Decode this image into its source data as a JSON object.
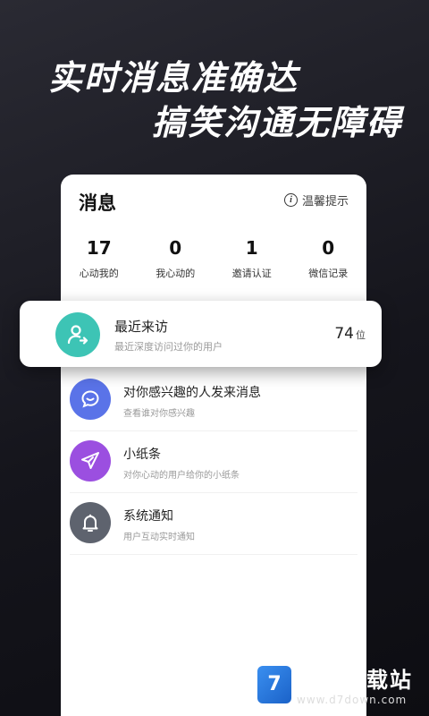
{
  "headline": {
    "line1": "实时消息准确达",
    "line2": "搞笑沟通无障碍"
  },
  "card": {
    "title": "消息",
    "tip_label": "温馨提示",
    "tip_icon": "info-icon",
    "stats": [
      {
        "value": "17",
        "label": "心动我的"
      },
      {
        "value": "0",
        "label": "我心动的"
      },
      {
        "value": "1",
        "label": "邀请认证"
      },
      {
        "value": "0",
        "label": "微信记录"
      }
    ]
  },
  "recent_visit": {
    "title": "最近来访",
    "subtitle": "最近深度访问过你的用户",
    "count": "74",
    "count_unit": "位",
    "icon": "user-visit-icon",
    "color": "#3dc4b5"
  },
  "list": [
    {
      "title": "对你感兴趣的人发来消息",
      "subtitle": "查看谁对你感兴趣",
      "icon": "chat-bubble-icon",
      "color": "#5a73e8"
    },
    {
      "title": "小纸条",
      "subtitle": "对你心动的用户给你的小纸条",
      "icon": "paper-plane-icon",
      "color": "#9b4fe0"
    },
    {
      "title": "系统通知",
      "subtitle": "用户互动实时通知",
      "icon": "bell-icon",
      "color": "#5e636e"
    }
  ],
  "watermark": {
    "logo": "7",
    "title": "第七下载站",
    "url": "www.d7down.com"
  }
}
